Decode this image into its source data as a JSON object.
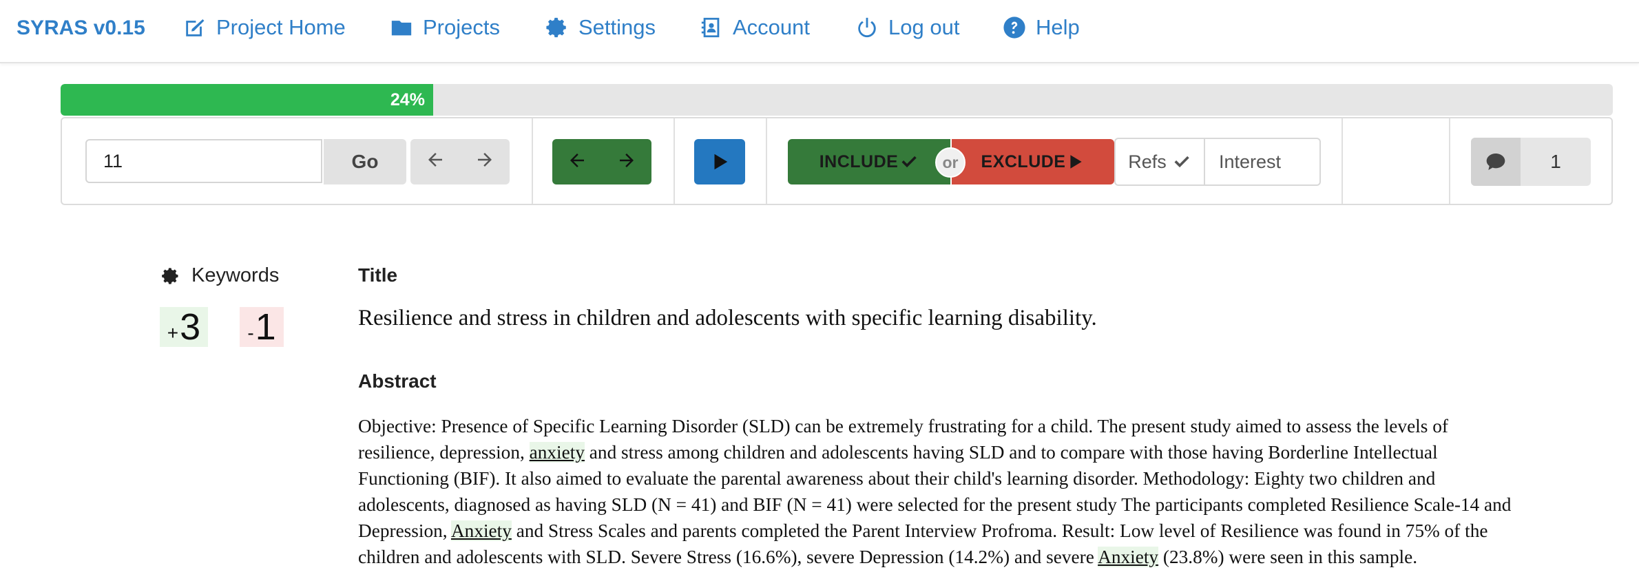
{
  "nav": {
    "brand": "SYRAS v0.15",
    "items": [
      {
        "label": "Project Home",
        "icon": "edit-icon"
      },
      {
        "label": "Projects",
        "icon": "folder-icon"
      },
      {
        "label": "Settings",
        "icon": "gear-icon"
      },
      {
        "label": "Account",
        "icon": "contact-card-icon"
      },
      {
        "label": "Log out",
        "icon": "power-icon"
      },
      {
        "label": "Help",
        "icon": "question-circle-icon"
      }
    ]
  },
  "progress": {
    "percent": 24,
    "label": "24%"
  },
  "toolbar": {
    "page_input_value": "11",
    "go_label": "Go",
    "include_label": "INCLUDE",
    "or_label": "or",
    "exclude_label": "EXCLUDE",
    "refs_label": "Refs",
    "interest_label": "Interest",
    "comment_count": "1"
  },
  "keywords": {
    "label": "Keywords",
    "positive_sign": "+",
    "positive_count": "3",
    "negative_sign": "-",
    "negative_count": "1"
  },
  "record": {
    "title_heading": "Title",
    "title": "Resilience and stress in children and adolescents with specific learning disability.",
    "abstract_heading": "Abstract",
    "abstract_parts": [
      "Objective: Presence of Specific Learning Disorder (SLD) can be extremely frustrating for a child. The present study aimed to assess the levels of resilience, depression, ",
      "anxiety",
      " and stress among children and adolescents having SLD and to compare with those having Borderline Intellectual Functioning (BIF). It also aimed to evaluate the parental awareness about their child's learning disorder. Methodology: Eighty two children and adolescents, diagnosed as having SLD (N = 41) and BIF (N = 41) were selected for the present study The participants completed Resilience Scale-14 and Depression, ",
      "Anxiety",
      " and Stress Scales and parents completed the Parent Interview Profroma. Result: Low level of Resilience was found in 75% of the children and adolescents with SLD. Severe Stress (16.6%), severe Depression (14.2%) and severe ",
      "Anxiety",
      " (23.8%) were seen in this sample."
    ]
  },
  "colors": {
    "brand_blue": "#2f7fc8",
    "progress_green": "#2eb851",
    "include_green": "#357a3a",
    "play_blue": "#2478c0",
    "exclude_red": "#d24b3d",
    "keyword_pos_bg": "#e9f6e8",
    "keyword_neg_bg": "#fbe6e6"
  }
}
